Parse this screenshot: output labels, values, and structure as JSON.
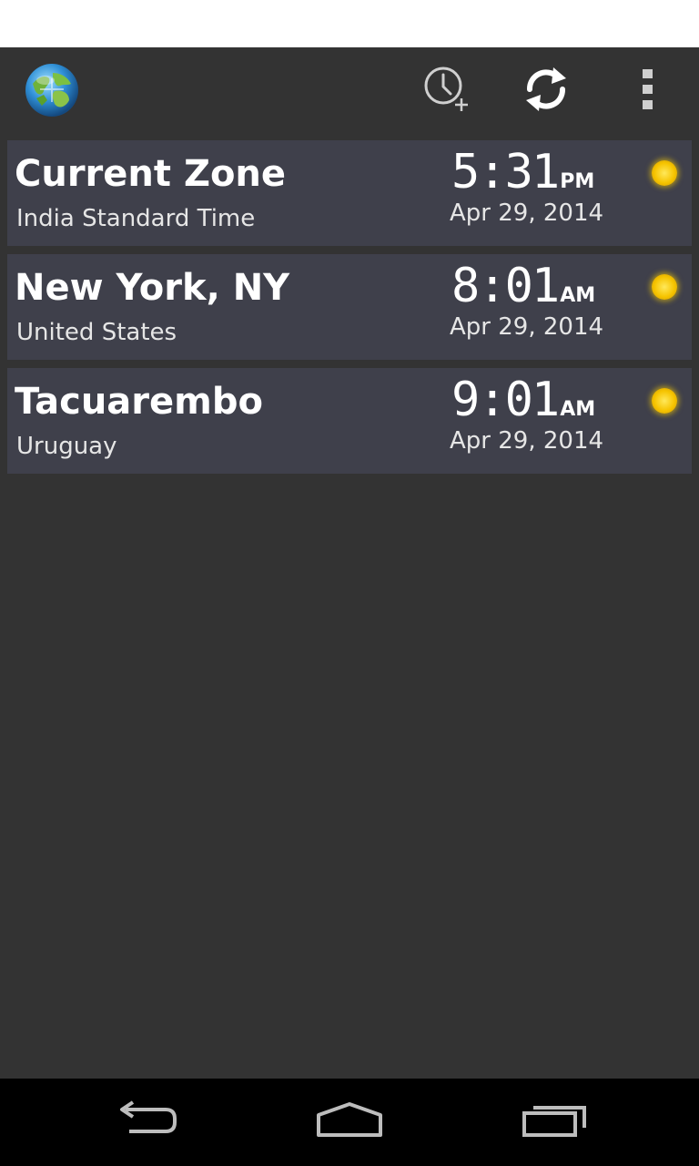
{
  "action_bar": {
    "app_icon": "globe-icon",
    "actions": [
      {
        "name": "add-clock",
        "icon": "clock-plus-icon"
      },
      {
        "name": "refresh",
        "icon": "refresh-icon"
      },
      {
        "name": "overflow",
        "icon": "overflow-menu-icon"
      }
    ]
  },
  "zones": [
    {
      "title": "Current Zone",
      "subtitle": "India Standard Time",
      "time": "5:31",
      "ampm": "PM",
      "date": "Apr 29, 2014",
      "icon": "sun-icon"
    },
    {
      "title": "New York, NY",
      "subtitle": "United States",
      "time": "8:01",
      "ampm": "AM",
      "date": "Apr 29, 2014",
      "icon": "sun-icon"
    },
    {
      "title": "Tacuarembo",
      "subtitle": "Uruguay",
      "time": "9:01",
      "ampm": "AM",
      "date": "Apr 29, 2014",
      "icon": "sun-icon"
    }
  ],
  "colors": {
    "background": "#333333",
    "card": "#3f404b",
    "sun": "#f6c400"
  },
  "nav_bar": {
    "buttons": [
      "back-icon",
      "home-icon",
      "recents-icon"
    ]
  }
}
